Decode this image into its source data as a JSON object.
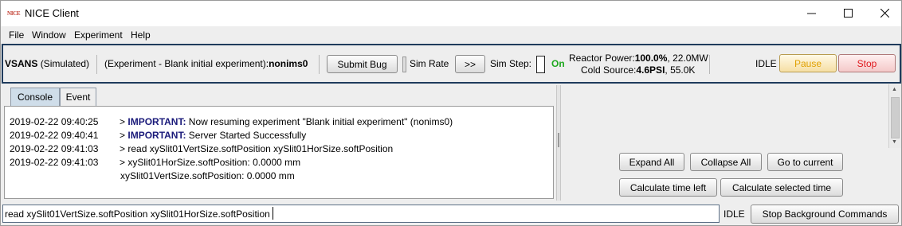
{
  "window": {
    "title": "NICE Client",
    "icon_text": "NICE"
  },
  "menu": [
    "File",
    "Window",
    "Experiment",
    "Help"
  ],
  "toolbar": {
    "instrument": "VSANS",
    "instrument_mode": "(Simulated)",
    "experiment_prefix": "(Experiment - Blank initial experiment):",
    "experiment_id": "nonims0",
    "submit_bug": "Submit Bug",
    "handle_dot": ".",
    "sim_rate_label": "Sim Rate",
    "sim_rate_button": ">>",
    "sim_step_label": "Sim Step:",
    "sim_on": "On",
    "reactor_power_label": "Reactor Power:",
    "reactor_power_value": "100.0%",
    "reactor_power_rest": ", 22.0MW",
    "cold_source_label": "Cold Source:",
    "cold_source_value": "4.6PSI",
    "cold_source_rest": ", 55.0K",
    "status": "IDLE",
    "pause": "Pause",
    "stop": "Stop",
    "colors": {
      "border": "#1f3b5c",
      "on_green": "#1fa81f",
      "pause": "#e0a000",
      "stop": "#e0191e"
    }
  },
  "tabs": {
    "console": "Console",
    "event": "Event"
  },
  "console": {
    "lines": [
      {
        "ts": "2019-02-22 09:40:25",
        "arrow": ">",
        "tag": "IMPORTANT:",
        "msg": " Now resuming experiment \"Blank initial experiment\" (nonims0)"
      },
      {
        "ts": "2019-02-22 09:40:41",
        "arrow": ">",
        "tag": "IMPORTANT:",
        "msg": " Server Started Successfully"
      },
      {
        "ts": "2019-02-22 09:41:03",
        "arrow": ">",
        "tag": "",
        "msg": "read xySlit01VertSize.softPosition xySlit01HorSize.softPosition"
      },
      {
        "ts": "2019-02-22 09:41:03",
        "arrow": ">",
        "tag": "",
        "msg": "xySlit01HorSize.softPosition:  0.0000 mm"
      },
      {
        "ts": "",
        "arrow": "",
        "tag": "",
        "msg": "xySlit01VertSize.softPosition: 0.0000 mm"
      }
    ]
  },
  "right_panel": {
    "expand_all": "Expand All",
    "collapse_all": "Collapse All",
    "go_to_current": "Go to current",
    "calc_time_left": "Calculate time left",
    "calc_selected_time": "Calculate selected time"
  },
  "bottom": {
    "command_value": "read xySlit01VertSize.softPosition xySlit01HorSize.softPosition",
    "status": "IDLE",
    "stop_bg": "Stop Background Commands"
  }
}
